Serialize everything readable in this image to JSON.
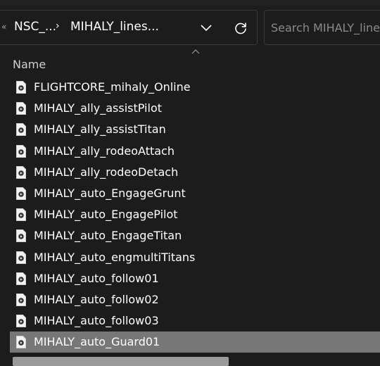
{
  "address_bar": {
    "overflow_glyph": "«",
    "crumbs": [
      "NSC_...",
      "MIHALY_lines..."
    ],
    "separator": "›"
  },
  "search": {
    "placeholder": "Search MIHALY_lines"
  },
  "column": {
    "name_header": "Name",
    "sort": "descending"
  },
  "files": [
    "FLIGHTCORE_mihaly_Online",
    "MIHALY_ally_assistPilot",
    "MIHALY_ally_assistTitan",
    "MIHALY_ally_rodeoAttach",
    "MIHALY_ally_rodeoDetach",
    "MIHALY_auto_EngageGrunt",
    "MIHALY_auto_EngagePilot",
    "MIHALY_auto_EngageTitan",
    "MIHALY_auto_engmultiTitans",
    "MIHALY_auto_follow01",
    "MIHALY_auto_follow02",
    "MIHALY_auto_follow03",
    "MIHALY_auto_Guard01"
  ],
  "selected_file": "MIHALY_auto_Guard01",
  "icons": {
    "file": "audio-file-icon",
    "dropdown": "chevron-down-icon",
    "refresh": "refresh-icon",
    "sort": "sort-up-icon"
  },
  "colors": {
    "background": "#1c1c1c",
    "selection": "#777777",
    "border": "#3a3a3a"
  }
}
